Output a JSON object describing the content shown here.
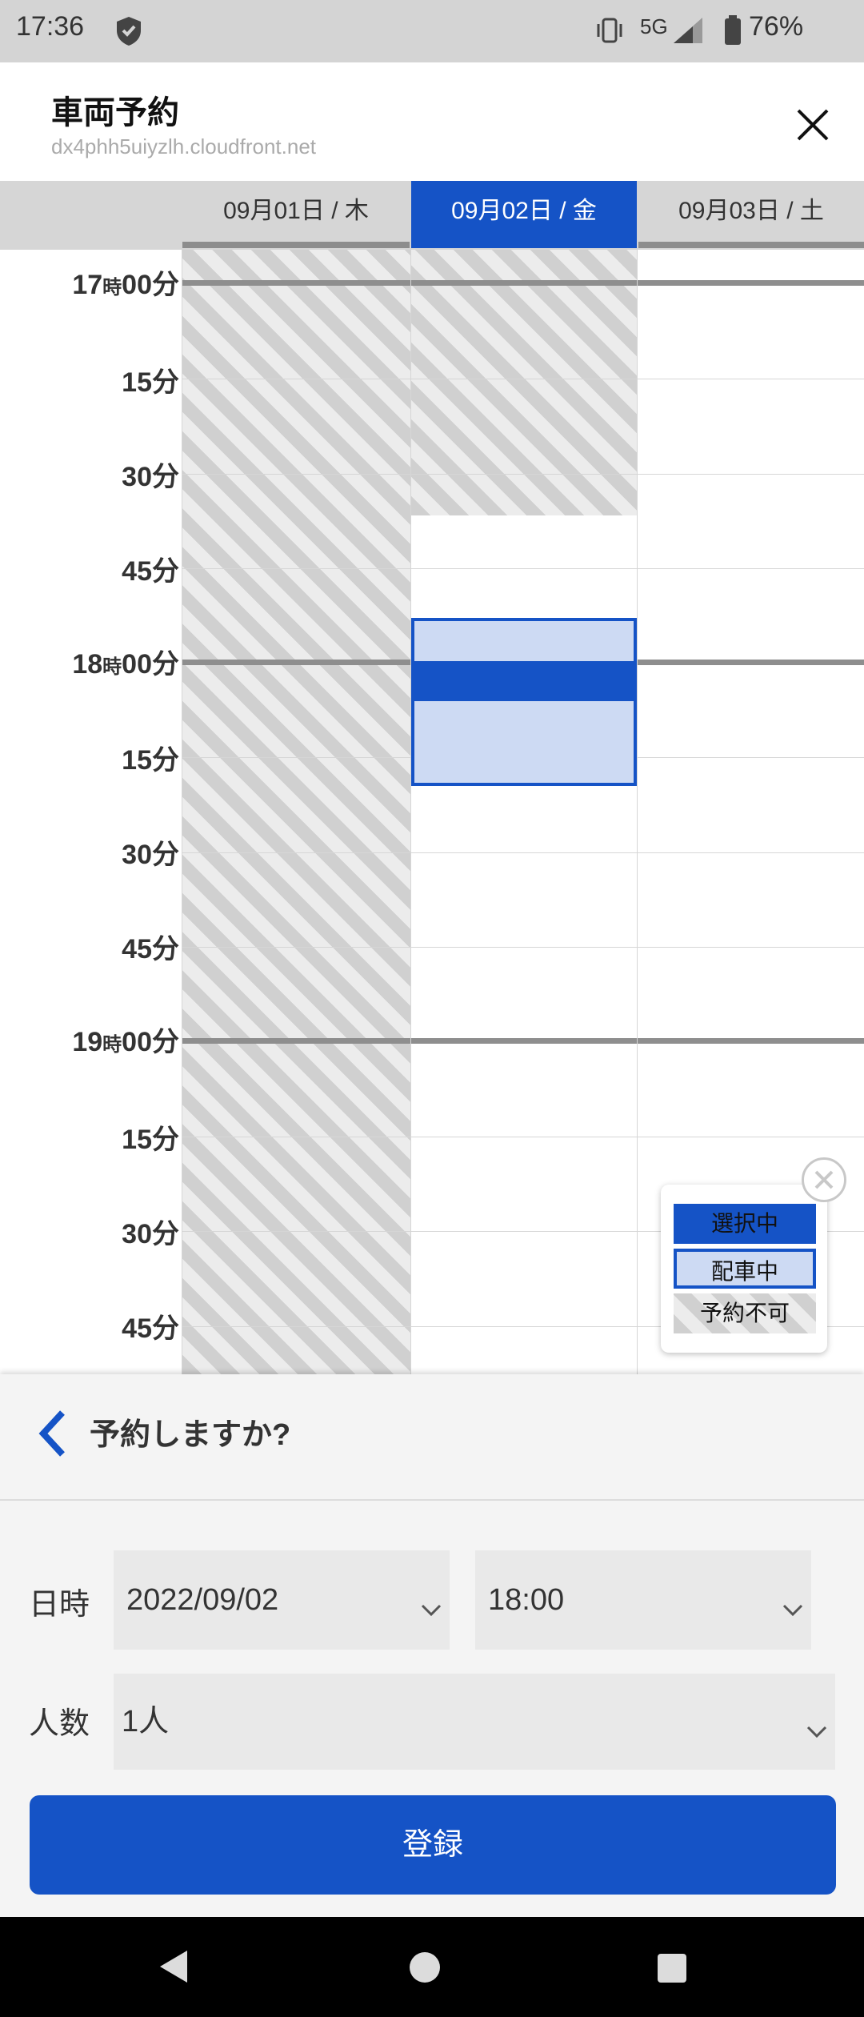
{
  "status_bar": {
    "time": "17:36",
    "network": "5G",
    "battery": "76%",
    "icons": [
      "shield-icon",
      "vibrate-icon",
      "signal-icon",
      "battery-icon"
    ]
  },
  "header": {
    "title": "車両予約",
    "url": "dx4phh5uiyzlh.cloudfront.net",
    "close_icon": "close-icon"
  },
  "days": [
    {
      "label": "09月01日 / 木",
      "selected": false
    },
    {
      "label": "09月02日 / 金",
      "selected": true
    },
    {
      "label": "09月03日 / 土",
      "selected": false
    }
  ],
  "time_rows": [
    {
      "hour": "17",
      "ji": "時",
      "min": "00分"
    },
    {
      "min": "15分"
    },
    {
      "min": "30分"
    },
    {
      "min": "45分"
    },
    {
      "hour": "18",
      "ji": "時",
      "min": "00分"
    },
    {
      "min": "15分"
    },
    {
      "min": "30分"
    },
    {
      "min": "45分"
    },
    {
      "hour": "19",
      "ji": "時",
      "min": "00分"
    },
    {
      "min": "15分"
    },
    {
      "min": "30分"
    },
    {
      "min": "45分"
    }
  ],
  "legend": {
    "selected": "選択中",
    "dispatched": "配車中",
    "unavailable": "予約不可"
  },
  "sheet": {
    "question": "予約しますか?",
    "datetime_label": "日時",
    "date_value": "2022/09/02",
    "time_value": "18:00",
    "people_label": "人数",
    "people_value": "1人",
    "submit_label": "登録"
  },
  "colors": {
    "accent": "#1553c6",
    "dispatched_fill": "#cddaf3",
    "hour_line": "#8e8e8e"
  }
}
